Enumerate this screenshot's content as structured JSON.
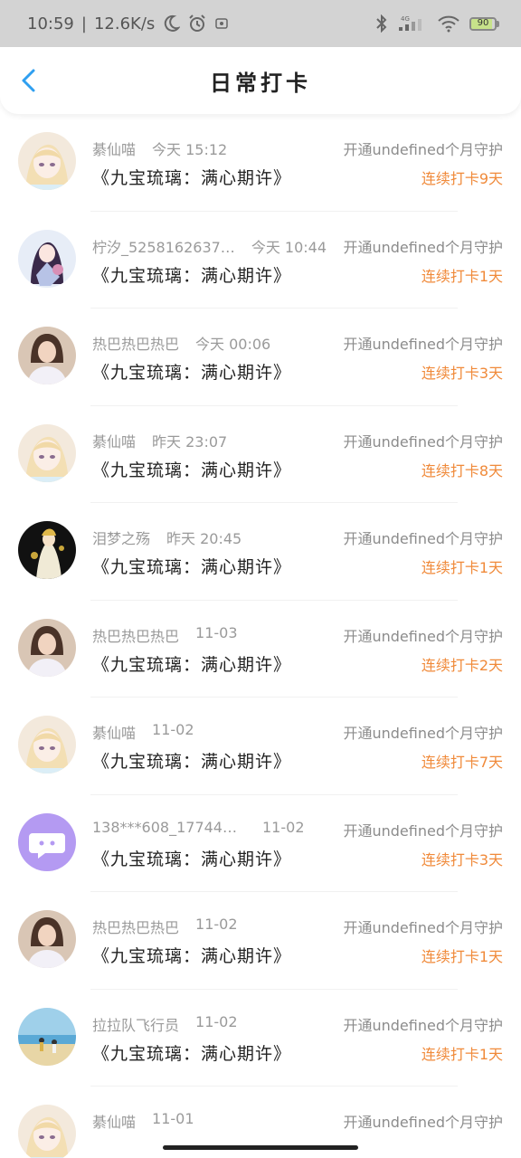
{
  "status_bar": {
    "time": "10:59",
    "speed": "12.6K/s",
    "signal": "4G",
    "battery_level": "90",
    "battery_color": "#c7e28a"
  },
  "header": {
    "title": "日常打卡",
    "back_icon": "chevron-left-icon",
    "accent": "#2f9ff0"
  },
  "colors": {
    "streak": "#f08a3a",
    "meta": "#9a9a9a"
  },
  "items": [
    {
      "name": "綦仙喵",
      "time": "今天 15:12",
      "book": "《九宝琉璃：满心期许》",
      "guard": "开通undefined个月守护",
      "streak": "连续打卡9天",
      "avatar": "anime-girl"
    },
    {
      "name": "柠汐_5258162637…",
      "time": "今天 10:44",
      "book": "《九宝琉璃：满心期许》",
      "guard": "开通undefined个月守护",
      "streak": "连续打卡1天",
      "avatar": "anime-dark"
    },
    {
      "name": "热巴热巴热巴",
      "time": "今天 00:06",
      "book": "《九宝琉璃：满心期许》",
      "guard": "开通undefined个月守护",
      "streak": "连续打卡3天",
      "avatar": "woman"
    },
    {
      "name": "綦仙喵",
      "time": "昨天 23:07",
      "book": "《九宝琉璃：满心期许》",
      "guard": "开通undefined个月守护",
      "streak": "连续打卡8天",
      "avatar": "anime-girl"
    },
    {
      "name": "泪梦之殇",
      "time": "昨天 20:45",
      "book": "《九宝琉璃：满心期许》",
      "guard": "开通undefined个月守护",
      "streak": "连续打卡1天",
      "avatar": "anime-gold"
    },
    {
      "name": "热巴热巴热巴",
      "time": "11-03",
      "book": "《九宝琉璃：满心期许》",
      "guard": "开通undefined个月守护",
      "streak": "连续打卡2天",
      "avatar": "woman"
    },
    {
      "name": "綦仙喵",
      "time": "11-02",
      "book": "《九宝琉璃：满心期许》",
      "guard": "开通undefined个月守护",
      "streak": "连续打卡7天",
      "avatar": "anime-girl"
    },
    {
      "name": "138***608_177449…",
      "time": "11-02",
      "book": "《九宝琉璃：满心期许》",
      "guard": "开通undefined个月守护",
      "streak": "连续打卡3天",
      "avatar": "default-chat"
    },
    {
      "name": "热巴热巴热巴",
      "time": "11-02",
      "book": "《九宝琉璃：满心期许》",
      "guard": "开通undefined个月守护",
      "streak": "连续打卡1天",
      "avatar": "woman"
    },
    {
      "name": "拉拉队飞行员",
      "time": "11-02",
      "book": "《九宝琉璃：满心期许》",
      "guard": "开通undefined个月守护",
      "streak": "连续打卡1天",
      "avatar": "beach"
    },
    {
      "name": "綦仙喵",
      "time": "11-01",
      "book": "",
      "guard": "开通undefined个月守护",
      "streak": "",
      "avatar": "anime-girl"
    }
  ]
}
